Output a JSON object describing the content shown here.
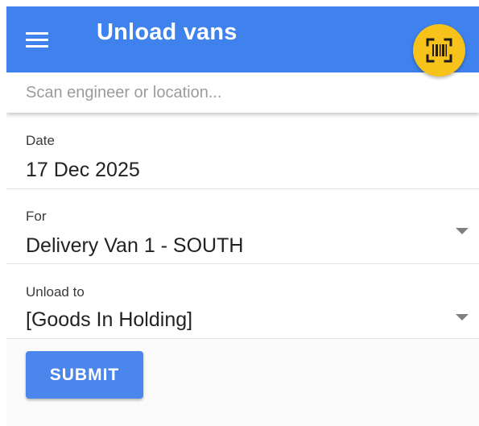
{
  "app_bar": {
    "title": "Unload vans",
    "menu_icon": "hamburger-menu-icon",
    "scan_icon": "barcode-scan-icon",
    "color": "#3f82ee",
    "fab_color": "#f7c31a"
  },
  "search": {
    "placeholder": "Scan engineer or location...",
    "value": ""
  },
  "form": {
    "date": {
      "label": "Date",
      "value": "17 Dec 2025"
    },
    "for": {
      "label": "For",
      "value": "Delivery Van 1 - SOUTH",
      "icon": "dropdown-arrow-icon"
    },
    "unload_to": {
      "label": "Unload to",
      "value": "[Goods In Holding]",
      "icon": "dropdown-arrow-icon"
    }
  },
  "actions": {
    "submit_label": "SUBMIT",
    "submit_color": "#4a86ec"
  }
}
